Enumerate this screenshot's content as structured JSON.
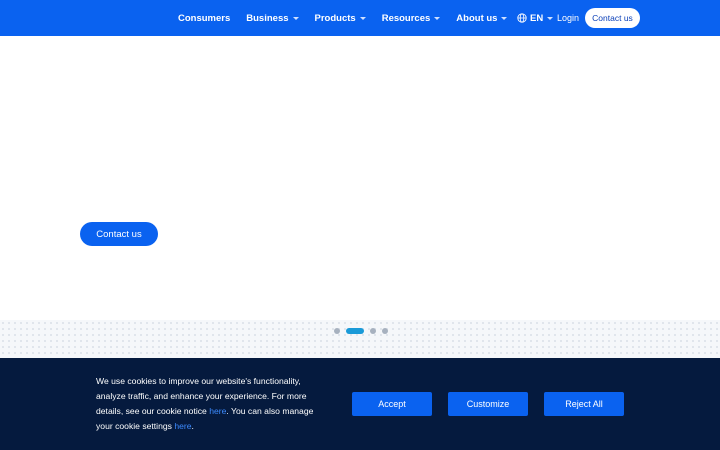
{
  "nav": {
    "items": [
      {
        "label": "Consumers",
        "dropdown": false
      },
      {
        "label": "Business",
        "dropdown": true
      },
      {
        "label": "Products",
        "dropdown": true
      },
      {
        "label": "Resources",
        "dropdown": true
      },
      {
        "label": "About us",
        "dropdown": true
      }
    ],
    "language": "EN",
    "login": "Login",
    "cta": "Contact us"
  },
  "hero": {
    "cta": "Contact us"
  },
  "carousel": {
    "slide_count": 4,
    "active_index": 1
  },
  "cookie": {
    "text_1": "We use cookies to improve our website's functionality, analyze traffic, and enhance your experience. For more details, see our cookie notice ",
    "link_1": "here",
    "text_2": ". You can also manage your cookie settings ",
    "link_2": "here",
    "text_3": ".",
    "accept": "Accept",
    "customize": "Customize",
    "reject": "Reject All"
  },
  "colors": {
    "nav_bg": "#0a62f0",
    "cookie_bg": "#051a3e",
    "link": "#3d8bff",
    "active_dot": "#1a9ad8"
  }
}
